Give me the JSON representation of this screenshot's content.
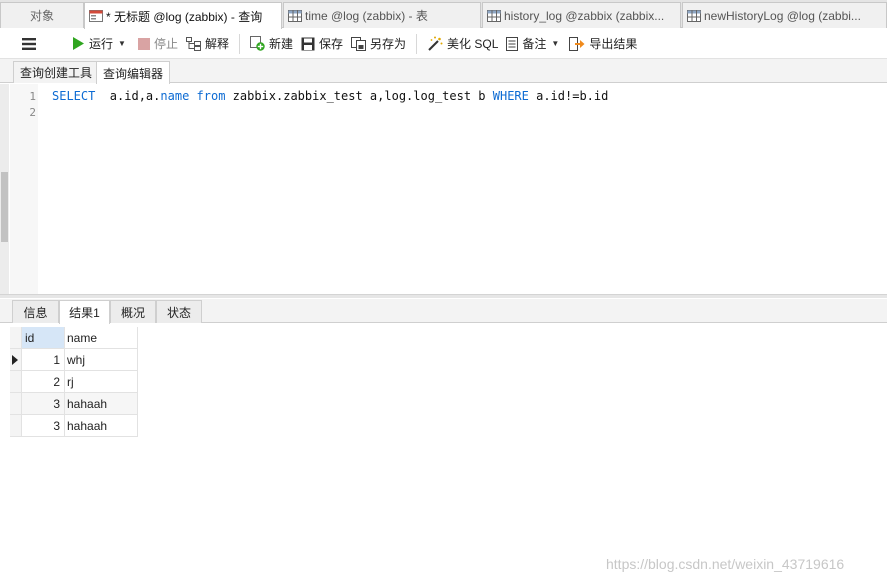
{
  "tabs": [
    {
      "label": "对象",
      "active": false,
      "icon": "none"
    },
    {
      "label": "* 无标题 @log (zabbix) - 查询",
      "active": true,
      "icon": "query-icon"
    },
    {
      "label": "time @log (zabbix) - 表",
      "active": false,
      "icon": "table-icon"
    },
    {
      "label": "history_log @zabbix (zabbix...",
      "active": false,
      "icon": "table-icon"
    },
    {
      "label": "newHistoryLog @log (zabbi...",
      "active": false,
      "icon": "table-icon"
    }
  ],
  "toolbar": {
    "menu_icon": "hamburger-icon",
    "run_label": "运行",
    "stop_label": "停止",
    "explain_label": "解释",
    "new_label": "新建",
    "save_label": "保存",
    "saveas_label": "另存为",
    "beautify_label": "美化 SQL",
    "note_label": "备注",
    "export_label": "导出结果"
  },
  "subtabs": {
    "builder": "查询创建工具",
    "editor": "查询编辑器"
  },
  "editor": {
    "line_numbers": [
      "1",
      "2"
    ],
    "sql": [
      {
        "t": "SELECT",
        "kw": true
      },
      {
        "t": "  a.id,a.",
        "kw": false
      },
      {
        "t": "name",
        "kw": true
      },
      {
        "t": " ",
        "kw": false
      },
      {
        "t": "from",
        "kw": true
      },
      {
        "t": " zabbix.zabbix_test a,log.log_test b ",
        "kw": false
      },
      {
        "t": "WHERE",
        "kw": true
      },
      {
        "t": " a.id!=b.id",
        "kw": false
      }
    ]
  },
  "result_tabs": [
    "信息",
    "结果1",
    "概况",
    "状态"
  ],
  "results": {
    "columns": [
      "id",
      "name"
    ],
    "rows": [
      {
        "id": "1",
        "name": "whj"
      },
      {
        "id": "2",
        "name": "rj"
      },
      {
        "id": "3",
        "name": "hahaah"
      },
      {
        "id": "3",
        "name": "hahaah"
      }
    ]
  },
  "watermark": "https://blog.csdn.net/weixin_43719616",
  "colors": {
    "keyword": "#0d6bd3",
    "run_green": "#2fa51f",
    "header_highlight": "#d6e6f7"
  }
}
